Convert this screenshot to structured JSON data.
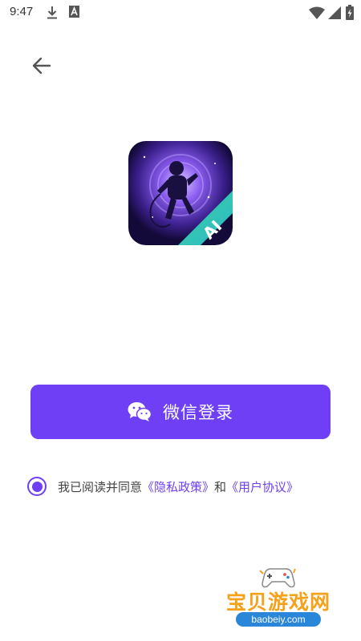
{
  "status_bar": {
    "time": "9:47",
    "left_icons": [
      "download-icon",
      "a-box-icon"
    ],
    "right_icons": [
      "wifi-icon",
      "signal-icon",
      "battery-charging-icon"
    ]
  },
  "header": {
    "back_icon": "back-arrow-icon"
  },
  "app_logo": {
    "badge_text": "AI",
    "icon": "astronaut-logo-icon"
  },
  "login": {
    "wechat_button_label": "微信登录",
    "wechat_icon": "wechat-icon"
  },
  "agreement": {
    "checked": true,
    "prefix": "我已阅读并同意",
    "privacy_link": "《隐私政策》",
    "connector": "和",
    "terms_link": "《用户协议》"
  },
  "watermark": {
    "title": "宝贝游戏网",
    "url": "baobeiy.com"
  },
  "colors": {
    "accent": "#6e3ff5",
    "watermark_orange": "#f5a11a",
    "watermark_blue": "#2a86d8"
  }
}
